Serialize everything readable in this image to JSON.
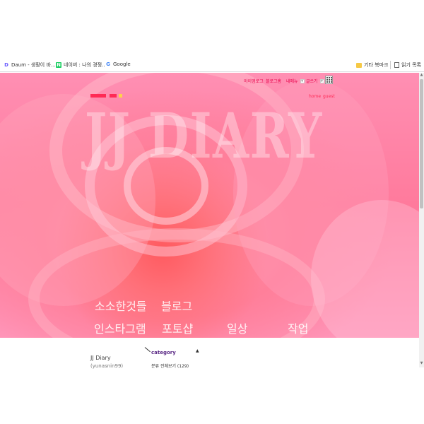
{
  "bookmarks": {
    "items": [
      {
        "label": "Daum - 생활이 바...",
        "icon": "daum-icon",
        "fav": "D"
      },
      {
        "label": "네이버 : 나의 경쟁...",
        "icon": "naver-icon",
        "fav": "N"
      },
      {
        "label": "Google",
        "icon": "google-icon",
        "fav": "G"
      }
    ],
    "other_bookmarks": "기타 북마크",
    "reading_list": "읽기 목록"
  },
  "hero": {
    "site_title": "JJ DIARY",
    "top_links": [
      "아이엠로그",
      "블로그홈",
      "내메뉴",
      "글쓰기"
    ],
    "account_links": [
      "home",
      "guest"
    ],
    "menu": [
      {
        "label": "소소한것들"
      },
      {
        "label": "블로그"
      },
      {
        "label": "인스타그램"
      },
      {
        "label": "포토샵"
      },
      {
        "label": "일상"
      },
      {
        "label": "작업"
      }
    ]
  },
  "profile": {
    "blog_name": "JJ Diary",
    "blog_id": "(yunasnin99)"
  },
  "category": {
    "title": "category",
    "total": "분류 전체보기 (129)"
  },
  "colors": {
    "accent": "#e8004a",
    "rose": "#ff7a9c",
    "category_title": "#5b2a86"
  }
}
